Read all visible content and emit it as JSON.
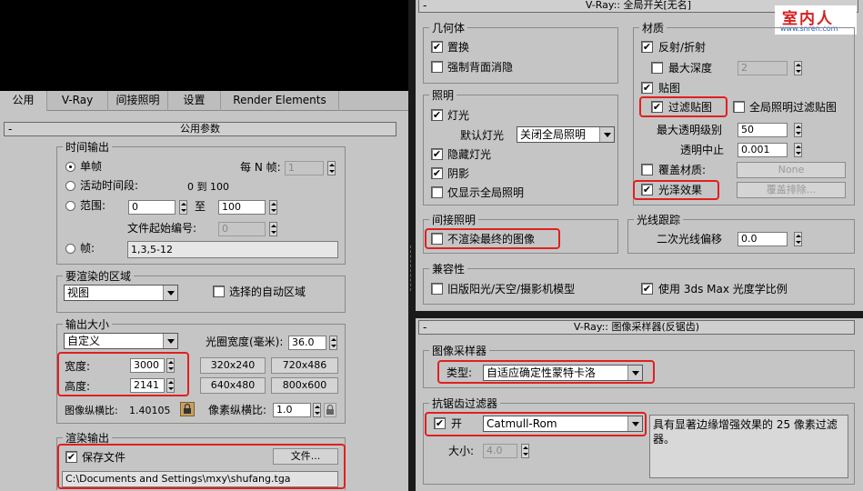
{
  "left": {
    "tabs": [
      "公用",
      "V-Ray",
      "间接照明",
      "设置",
      "Render Elements"
    ],
    "rollout_title": "公用参数",
    "time_output": {
      "title": "时间输出",
      "single": "单帧",
      "every_n_label": "每 N 帧:",
      "every_n_value": "1",
      "active_segment": "活动时间段:",
      "active_range": "0 到 100",
      "range": "范围:",
      "range_from": "0",
      "range_to_label": "至",
      "range_to": "100",
      "file_start_label": "文件起始编号:",
      "file_start_value": "0",
      "frames": "帧:",
      "frames_value": "1,3,5-12"
    },
    "render_area": {
      "title": "要渲染的区域",
      "select": "视图",
      "auto_region": "选择的自动区域"
    },
    "output_size": {
      "title": "输出大小",
      "preset": "自定义",
      "aperture_label": "光圈宽度(毫米):",
      "aperture_value": "36.0",
      "width_label": "宽度:",
      "width_value": "3000",
      "height_label": "高度:",
      "height_value": "2141",
      "presets": [
        "320x240",
        "720x486",
        "640x480",
        "800x600"
      ],
      "aspect_label": "图像纵横比:",
      "aspect_value": "1.40105",
      "pixel_aspect_label": "像素纵横比:",
      "pixel_aspect_value": "1.0"
    },
    "render_output": {
      "title": "渲染输出",
      "save_file": "保存文件",
      "files_button": "文件...",
      "path": "C:\\Documents and Settings\\mxy\\shufang.tga"
    }
  },
  "right": {
    "rollout_title": "V-Ray:: 全局开关[无名]",
    "watermark": {
      "text": "室内人",
      "url": "www.snren.com"
    },
    "geometry": {
      "title": "几何体",
      "displacement": "置换",
      "force_backface": "强制背面消隐"
    },
    "lighting": {
      "title": "照明",
      "lights": "灯光",
      "default_lights_label": "默认灯光",
      "default_lights_value": "关闭全局照明",
      "hidden_lights": "隐藏灯光",
      "shadows": "阴影",
      "show_gi_only": "仅显示全局照明"
    },
    "materials": {
      "title": "材质",
      "reflect_refract": "反射/折射",
      "max_depth": "最大深度",
      "max_depth_value": "2",
      "maps": "贴图",
      "filter_maps": "过滤贴图",
      "filter_maps_gi": "全局照明过滤贴图",
      "max_transp_label": "最大透明级别",
      "max_transp_value": "50",
      "transp_cutoff_label": "透明中止",
      "transp_cutoff_value": "0.001",
      "override_mtl": "覆盖材质:",
      "override_none": "None",
      "glossy": "光泽效果",
      "override_exclude": "覆盖排除..."
    },
    "indirect": {
      "title": "间接照明",
      "dont_render_final": "不渲染最终的图像"
    },
    "raytracing": {
      "title": "光线跟踪",
      "secondary_bias_label": "二次光线偏移",
      "secondary_bias_value": "0.0"
    },
    "compat": {
      "title": "兼容性",
      "legacy_sun": "旧版阳光/天空/摄影机模型",
      "use_3dsmax": "使用 3ds Max 光度学比例"
    },
    "sampler_rollout_title": "V-Ray:: 图像采样器(反锯齿)",
    "image_sampler": {
      "title": "图像采样器",
      "type_label": "类型:",
      "type_value": "自适应确定性蒙特卡洛"
    },
    "aa_filter": {
      "title": "抗锯齿过滤器",
      "on_label": "开",
      "filter_value": "Catmull-Rom",
      "description": "具有显著边缘增强效果的 25 像素过滤器。",
      "size_label": "大小:",
      "size_value": "4.0"
    }
  },
  "colors": {
    "panel": "#c5c5c5",
    "highlight": "#e02020",
    "watermark": "#d42020"
  }
}
